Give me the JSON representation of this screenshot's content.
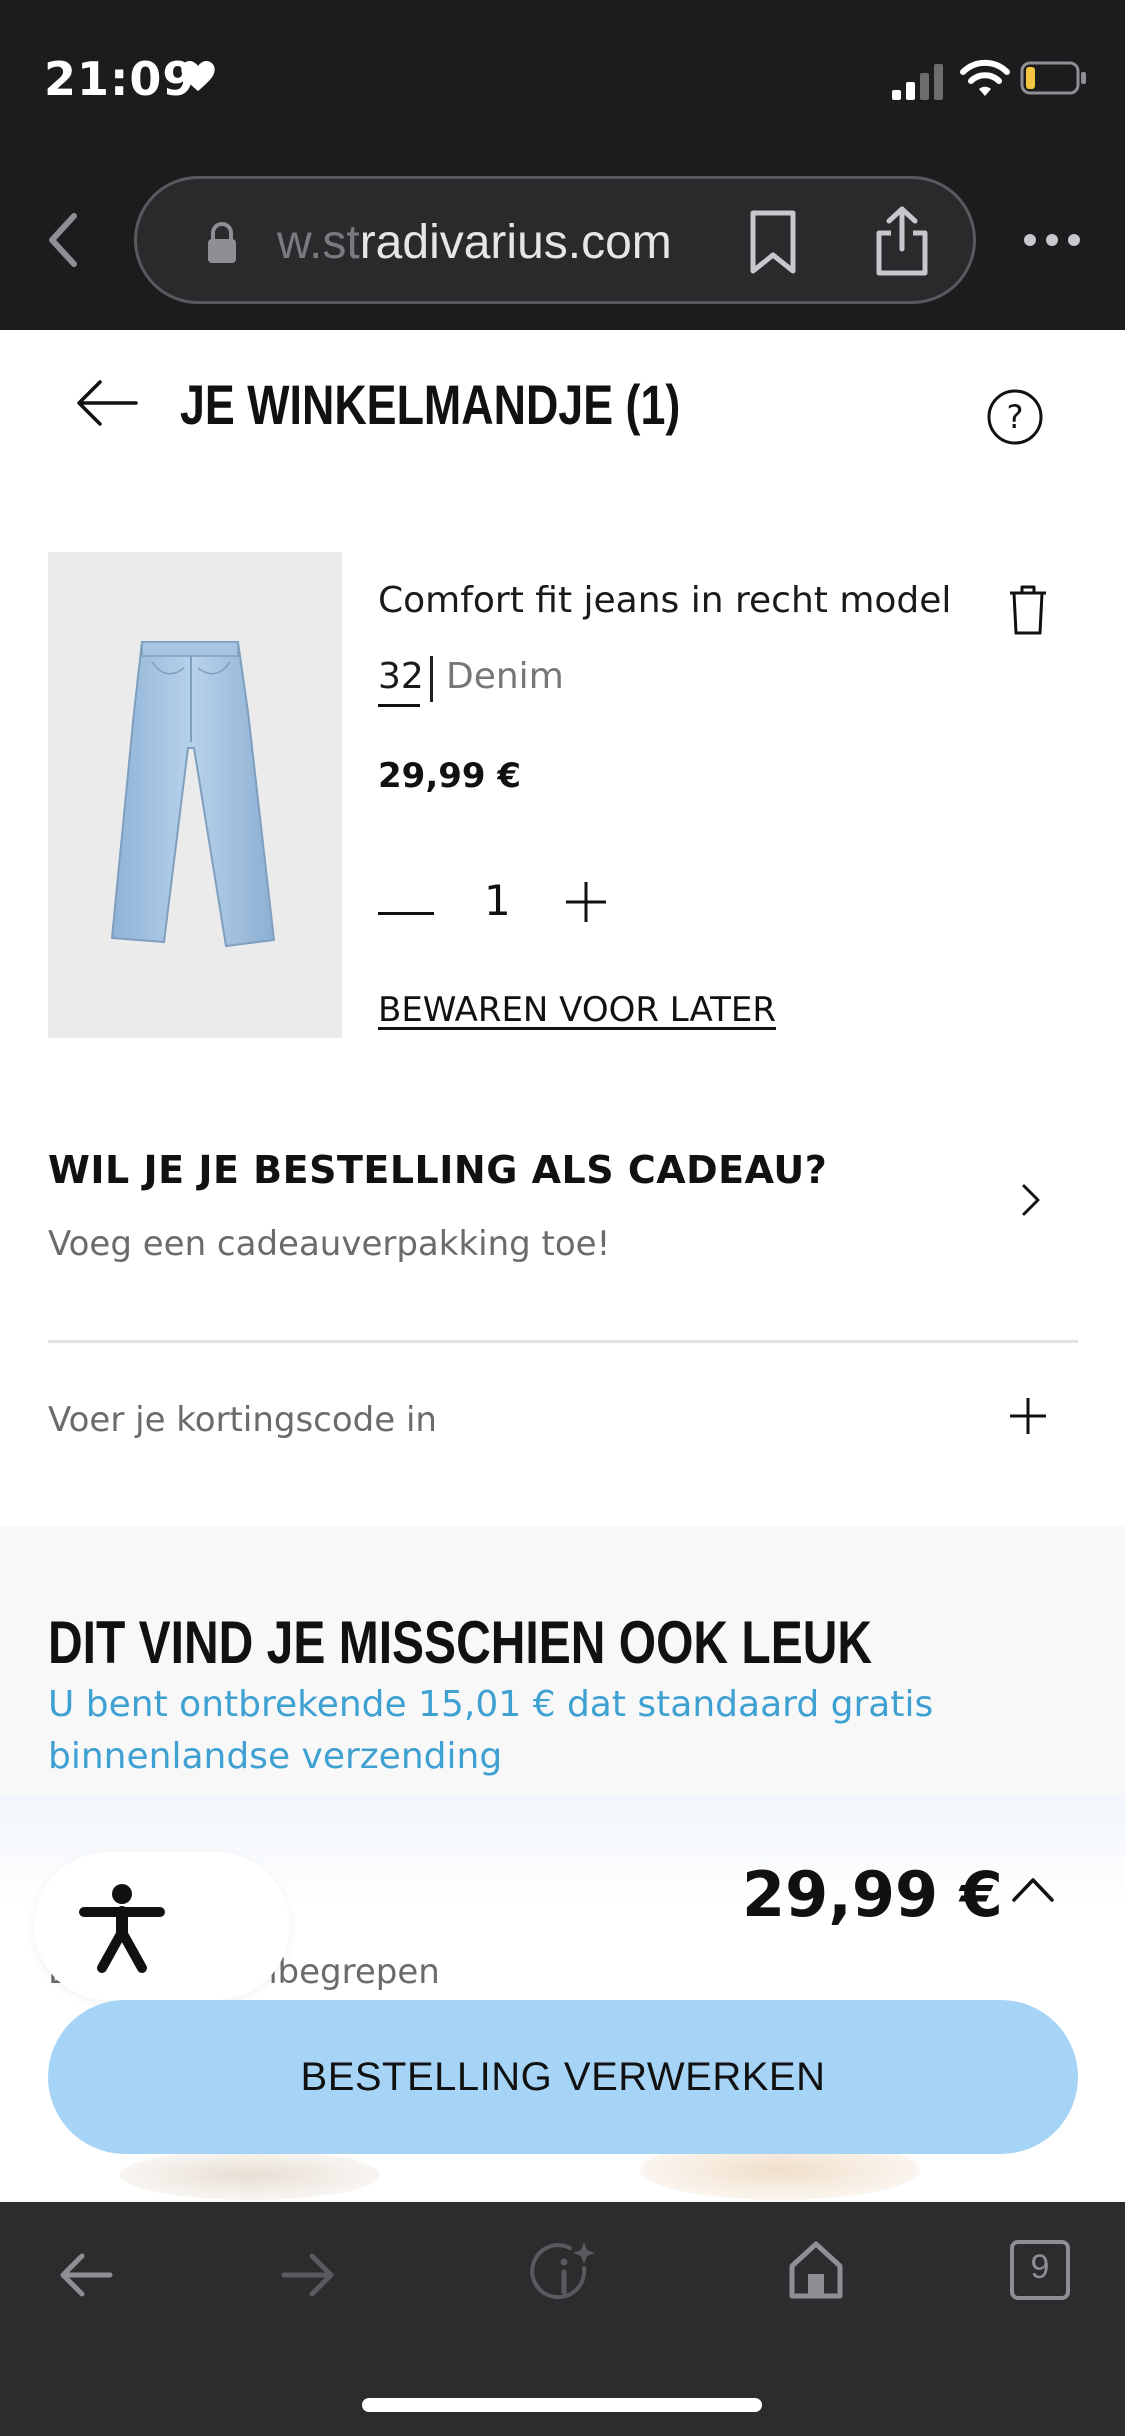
{
  "status_bar": {
    "time": "21:09",
    "heart_icon": "heart-icon",
    "signal_icon": "cellular-signal-icon",
    "wifi_icon": "wifi-icon",
    "battery_icon": "battery-low-icon",
    "battery_level": 0.15,
    "battery_color": "#f5c542"
  },
  "browser": {
    "url_faded": "w.st",
    "url_main": "radivarius.com",
    "lock_icon": "lock-icon",
    "bookmark_icon": "bookmark-icon",
    "share_icon": "share-icon",
    "more_icon": "more-dots-icon",
    "back_icon": "chevron-left-icon"
  },
  "cart": {
    "title": "JE WINKELMANDJE (1)",
    "back_icon": "arrow-left-icon",
    "help_icon": "help-question-icon"
  },
  "product": {
    "name": "Comfort fit jeans in recht model",
    "size": "32",
    "color": "Denim",
    "price": "29,99 €",
    "quantity": "1",
    "save_for_later": "BEWAREN VOOR LATER",
    "delete_icon": "trash-icon",
    "image_icon": "jeans-product-image"
  },
  "gift": {
    "title": "WIL JE JE BESTELLING ALS CADEAU?",
    "subtitle": "Voeg een cadeauverpakking toe!",
    "chevron_icon": "chevron-right-icon"
  },
  "discount": {
    "label": "Voer je kortingscode in",
    "plus_icon": "plus-icon"
  },
  "recommendations": {
    "title": "DIT VIND JE MISSCHIEN OOK LEUK",
    "shipping_line1": "U bent ontbrekende 15,01 €  dat standaard gratis",
    "shipping_line2": "binnenlandse verzending",
    "link_color": "#3fa0d2"
  },
  "checkout": {
    "total": "29,99 €",
    "vat_prefix": "B",
    "vat_note": "nbegrepen",
    "button_label": "BESTELLING VERWERKEN",
    "button_color": "#a6d4f7",
    "expand_icon": "chevron-up-icon",
    "accessibility_icon": "accessibility-person-icon"
  },
  "toolbar": {
    "back_icon": "arrow-left-icon",
    "forward_icon": "arrow-right-icon",
    "info_icon": "info-sparkle-icon",
    "home_icon": "home-icon",
    "tabs_count": "9"
  }
}
